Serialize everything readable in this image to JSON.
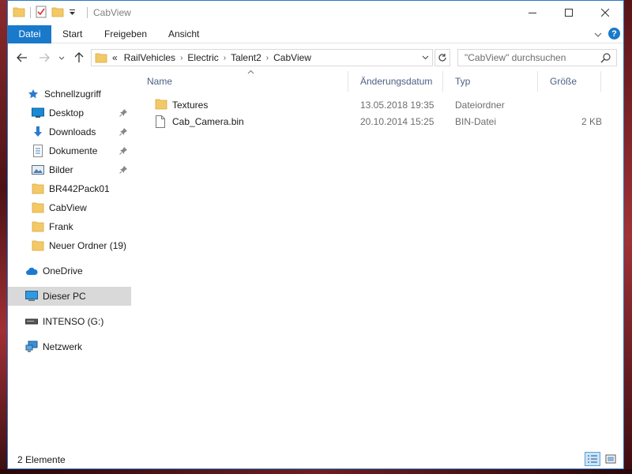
{
  "window": {
    "title": "CabView",
    "controls": {
      "minimize": "—",
      "maximize": "☐",
      "close": "✕"
    }
  },
  "ribbon": {
    "tabs": [
      {
        "label": "Datei",
        "active": true
      },
      {
        "label": "Start"
      },
      {
        "label": "Freigeben"
      },
      {
        "label": "Ansicht"
      }
    ],
    "help": "?"
  },
  "address": {
    "overflow": "«",
    "crumbs": [
      "RailVehicles",
      "Electric",
      "Talent2",
      "CabView"
    ],
    "separator": "›"
  },
  "search": {
    "placeholder": "\"CabView\" durchsuchen"
  },
  "sidebar": {
    "items": [
      {
        "label": "Schnellzugriff",
        "icon": "star-icon",
        "level": 0
      },
      {
        "label": "Desktop",
        "icon": "desktop-icon",
        "level": 1,
        "pinned": true
      },
      {
        "label": "Downloads",
        "icon": "download-icon",
        "level": 1,
        "pinned": true
      },
      {
        "label": "Dokumente",
        "icon": "documents-icon",
        "level": 1,
        "pinned": true
      },
      {
        "label": "Bilder",
        "icon": "pictures-icon",
        "level": 1,
        "pinned": true
      },
      {
        "label": "BR442Pack01",
        "icon": "folder-icon",
        "level": 1
      },
      {
        "label": "CabView",
        "icon": "folder-icon",
        "level": 1
      },
      {
        "label": "Frank",
        "icon": "folder-icon",
        "level": 1
      },
      {
        "label": "Neuer Ordner (19)",
        "icon": "folder-icon",
        "level": 1
      },
      {
        "label": "OneDrive",
        "icon": "cloud-icon",
        "level": 0
      },
      {
        "label": "Dieser PC",
        "icon": "computer-icon",
        "level": 0,
        "selected": true
      },
      {
        "label": "INTENSO (G:)",
        "icon": "drive-icon",
        "level": 0
      },
      {
        "label": "Netzwerk",
        "icon": "network-icon",
        "level": 0
      }
    ]
  },
  "columns": {
    "name": "Name",
    "date": "Änderungsdatum",
    "type": "Typ",
    "size": "Größe"
  },
  "files": [
    {
      "name": "Textures",
      "date": "13.05.2018 19:35",
      "type": "Dateiordner",
      "size": "",
      "icon": "folder-icon"
    },
    {
      "name": "Cab_Camera.bin",
      "date": "20.10.2014 15:25",
      "type": "BIN-Datei",
      "size": "2 KB",
      "icon": "file-icon"
    }
  ],
  "status": {
    "count": "2 Elemente"
  },
  "colors": {
    "accent": "#1979ca",
    "folder": "#f3c967",
    "selected": "#d9d9d9"
  }
}
